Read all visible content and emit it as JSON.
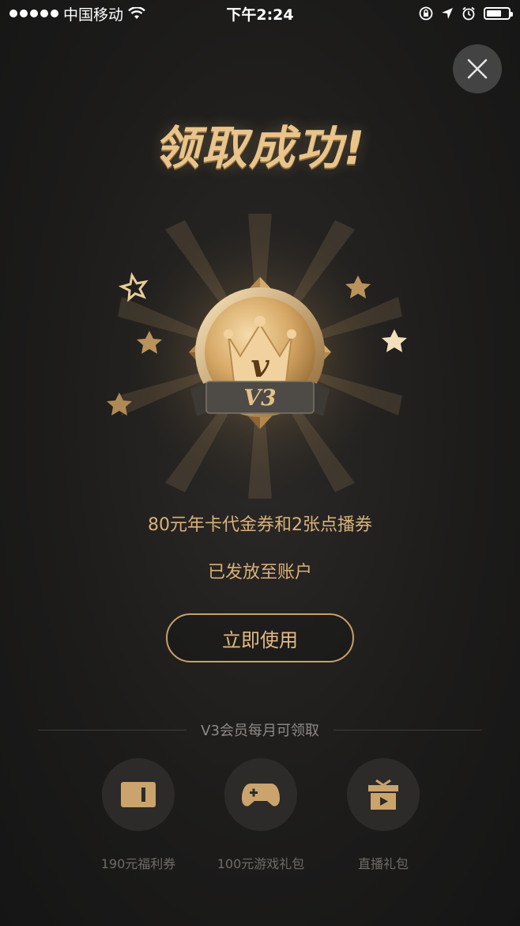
{
  "status_bar": {
    "carrier": "中国移动",
    "time": "下午2:24"
  },
  "title": "领取成功!",
  "badge": {
    "level_text": "V3",
    "letter": "v"
  },
  "reward": {
    "line1": "80元年卡代金券和2张点播券",
    "line2": "已发放至账户"
  },
  "use_button_label": "立即使用",
  "monthly_section": {
    "title": "V3会员每月可领取",
    "items": [
      {
        "label": "190元福利券",
        "icon": "ticket-icon"
      },
      {
        "label": "100元游戏礼包",
        "icon": "gamepad-icon"
      },
      {
        "label": "直播礼包",
        "icon": "live-gift-icon"
      }
    ]
  },
  "colors": {
    "gold": "#d9b07a",
    "button_border": "#c9a06a",
    "muted_text": "#6f6c68",
    "background": "#1d1c1b"
  }
}
